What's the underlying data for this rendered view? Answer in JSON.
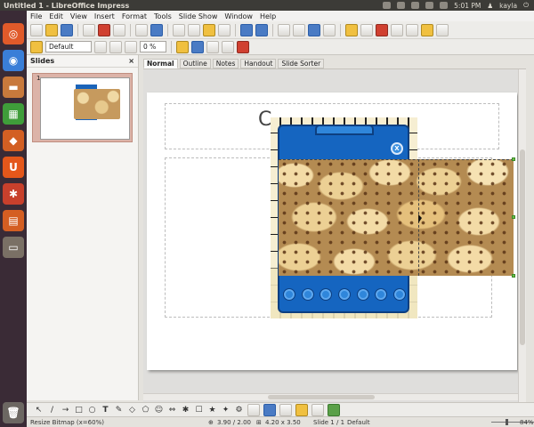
{
  "window": {
    "title": "Untitled 1 - LibreOffice Impress"
  },
  "tray": {
    "time": "5:01 PM",
    "user": "kayla"
  },
  "menu": [
    "File",
    "Edit",
    "View",
    "Insert",
    "Format",
    "Tools",
    "Slide Show",
    "Window",
    "Help"
  ],
  "toolbar2": {
    "style_value": "Default",
    "transparency_value": "0 %"
  },
  "slides_panel": {
    "title": "Slides",
    "close": "×",
    "slide_number": "1"
  },
  "tabs": [
    "Normal",
    "Outline",
    "Notes",
    "Handout",
    "Slide Sorter"
  ],
  "slide": {
    "title_fragment": "C"
  },
  "popup": {
    "close_glyph": "X"
  },
  "drawing_tools": [
    "↖",
    "/",
    "→",
    "□",
    "○",
    "T",
    "✎",
    "◇",
    "⬠",
    "☺",
    "⇔",
    "✱",
    "☐",
    "★",
    "✦",
    "⚙"
  ],
  "status": {
    "message": "Resize Bitmap (x=60%)",
    "position": "3.90 / 2.00",
    "size": "4.20 x 3.50",
    "slide": "Slide 1 / 1",
    "layout": "Default",
    "zoom": "84%"
  },
  "launcher": [
    {
      "icon": "ubuntu-dash-icon",
      "color": "#e05a2a",
      "glyph": "◎"
    },
    {
      "icon": "chromium-icon",
      "color": "#3a7ed8",
      "glyph": "◉"
    },
    {
      "icon": "files-icon",
      "color": "#c8793c",
      "glyph": "▬"
    },
    {
      "icon": "calc-icon",
      "color": "#3f9d3a",
      "glyph": "▦"
    },
    {
      "icon": "software-center-icon",
      "color": "#d35f23",
      "glyph": "◆"
    },
    {
      "icon": "ubuntu-one-icon",
      "color": "#e4571b",
      "glyph": "U"
    },
    {
      "icon": "settings-icon",
      "color": "#c8402c",
      "glyph": "✱"
    },
    {
      "icon": "impress-icon",
      "color": "#d45e22",
      "glyph": "▤"
    },
    {
      "icon": "workspaces-icon",
      "color": "#7a7065",
      "glyph": "▭"
    }
  ]
}
